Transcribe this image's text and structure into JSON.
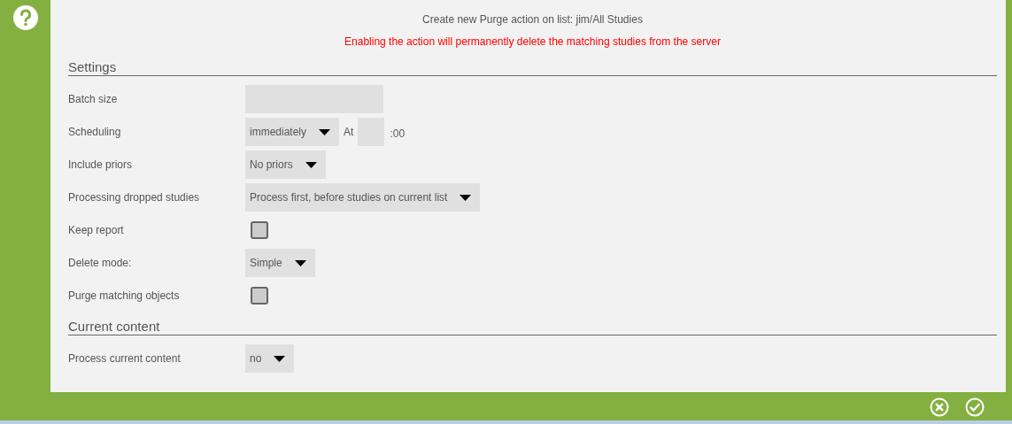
{
  "title": "Create new Purge action on list: jim/All Studies",
  "warning": "Enabling the action will permanently delete the matching studies from the server",
  "sections": [
    {
      "heading": "Settings",
      "rows": [
        {
          "label": "Batch size",
          "kind": "text"
        },
        {
          "label": "Scheduling",
          "kind": "schedule",
          "value": "immediately",
          "at_label": "At",
          "suffix": ":00"
        },
        {
          "label": "Include priors",
          "kind": "select",
          "value": "No priors"
        },
        {
          "label": "Processing dropped studies",
          "kind": "select",
          "value": "Process first, before studies on current list"
        },
        {
          "label": "Keep report",
          "kind": "checkbox",
          "checked": false
        },
        {
          "label": "Delete mode:",
          "kind": "select",
          "value": "Simple"
        },
        {
          "label": "Purge matching objects",
          "kind": "checkbox",
          "checked": false
        }
      ]
    },
    {
      "heading": "Current content",
      "rows": [
        {
          "label": "Process current content",
          "kind": "select",
          "value": "no"
        }
      ]
    }
  ]
}
